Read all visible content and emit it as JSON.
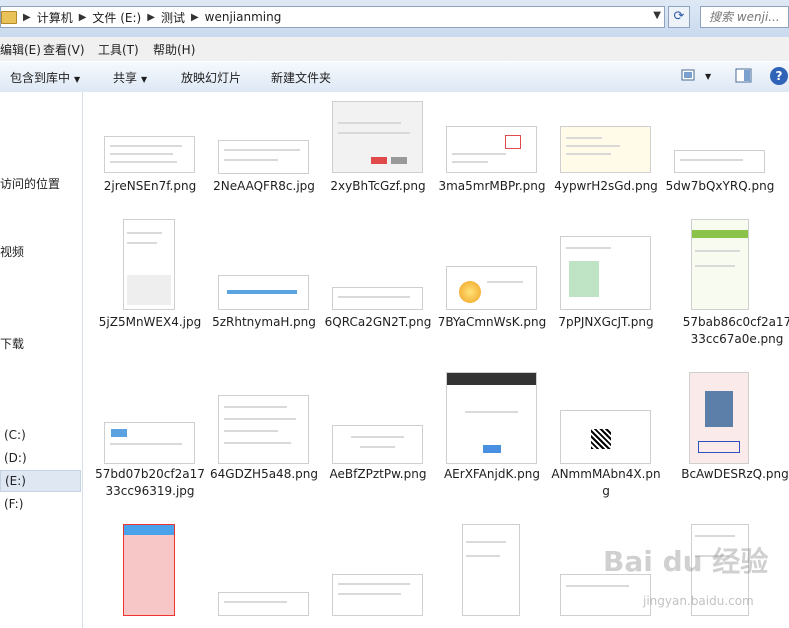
{
  "address": {
    "crumbs": [
      "计算机",
      "文件 (E:)",
      "测试",
      "wenjianming"
    ],
    "search_placeholder": "搜索 wenji..."
  },
  "menu": [
    "编辑(E)",
    "查看(V)",
    "工具(T)",
    "帮助(H)"
  ],
  "toolbar": {
    "include": "包含到库中",
    "share": "共享",
    "slideshow": "放映幻灯片",
    "new_folder": "新建文件夹"
  },
  "sidebar": {
    "items": [
      "访问的位置",
      "视频",
      "下载",
      "(C:)",
      "(D:)",
      "(E:)",
      "(F:)"
    ]
  },
  "files": [
    "2jreNSEn7f.png",
    "2NeAAQFR8c.jpg",
    "2xyBhTcGzf.png",
    "3ma5mrMBPr.png",
    "4ypwrH2sGd.png",
    "5dw7bQxYRQ.png",
    "5jZ5MnWEX4.jpg",
    "5zRhtnymaH.png",
    "6QRCa2GN2T.png",
    "7BYaCmnWsK.png",
    "7pPJNXGcJT.png",
    "57bab86c0cf2a1733cc67a0e.png",
    "57bd07b20cf2a1733cc96319.jpg",
    "64GDZH5a48.png",
    "AeBfZPztPw.png",
    "AErXFAnjdK.png",
    "ANmmMAbn4X.png",
    "BcAwDESRzQ.png"
  ],
  "watermark": {
    "logo": "Bai du 经验",
    "sub": "jingyan.baidu.com"
  },
  "colors": {
    "accent": "#2f63b8",
    "selected_bg": "#dfe7f2"
  }
}
